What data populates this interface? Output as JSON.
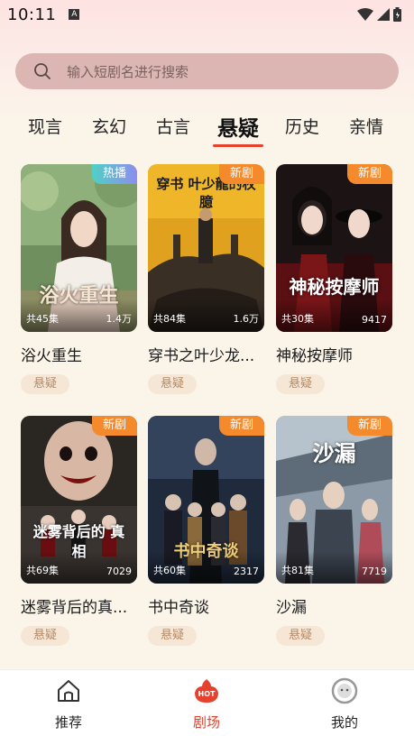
{
  "status_bar": {
    "time": "10:11",
    "notif_letter": "A"
  },
  "search": {
    "placeholder": "输入短剧名进行搜索"
  },
  "tabs": [
    {
      "label": "现言",
      "active": false
    },
    {
      "label": "玄幻",
      "active": false
    },
    {
      "label": "古言",
      "active": false
    },
    {
      "label": "悬疑",
      "active": true
    },
    {
      "label": "历史",
      "active": false
    },
    {
      "label": "亲情",
      "active": false
    }
  ],
  "dramas": [
    {
      "title": "浴火重生",
      "badge": "热播",
      "episodes": "共45集",
      "views": "1.4万",
      "genre": "悬疑",
      "poster_text": "浴火重生",
      "badge_color": "#8e8cf0"
    },
    {
      "title": "穿书之叶少龙...",
      "badge": "新剧",
      "episodes": "共84集",
      "views": "1.6万",
      "genre": "悬疑",
      "poster_text": "穿书 叶少龍的权臆",
      "badge_color": "#f58a2c"
    },
    {
      "title": "神秘按摩师",
      "badge": "新剧",
      "episodes": "共30集",
      "views": "9417",
      "genre": "悬疑",
      "poster_text": "神秘按摩师",
      "badge_color": "#f58a2c"
    },
    {
      "title": "迷雾背后的真...",
      "badge": "新剧",
      "episodes": "共69集",
      "views": "7029",
      "genre": "悬疑",
      "poster_text": "迷雾背后的 真相",
      "badge_color": "#f58a2c"
    },
    {
      "title": "书中奇谈",
      "badge": "新剧",
      "episodes": "共60集",
      "views": "2317",
      "genre": "悬疑",
      "poster_text": "书中奇谈",
      "badge_color": "#f58a2c"
    },
    {
      "title": "沙漏",
      "badge": "新剧",
      "episodes": "共81集",
      "views": "7719",
      "genre": "悬疑",
      "poster_text": "沙漏",
      "badge_color": "#f58a2c"
    }
  ],
  "bottom_nav": [
    {
      "label": "推荐",
      "icon": "home-icon",
      "active": false
    },
    {
      "label": "剧场",
      "icon": "hot-icon",
      "active": true,
      "icon_text": "HOT"
    },
    {
      "label": "我的",
      "icon": "profile-icon",
      "active": false
    }
  ],
  "colors": {
    "accent": "#e5412d",
    "search_bg": "#dcb6b2",
    "tag_bg": "#f6e6d6",
    "tag_text": "#b58a67"
  }
}
